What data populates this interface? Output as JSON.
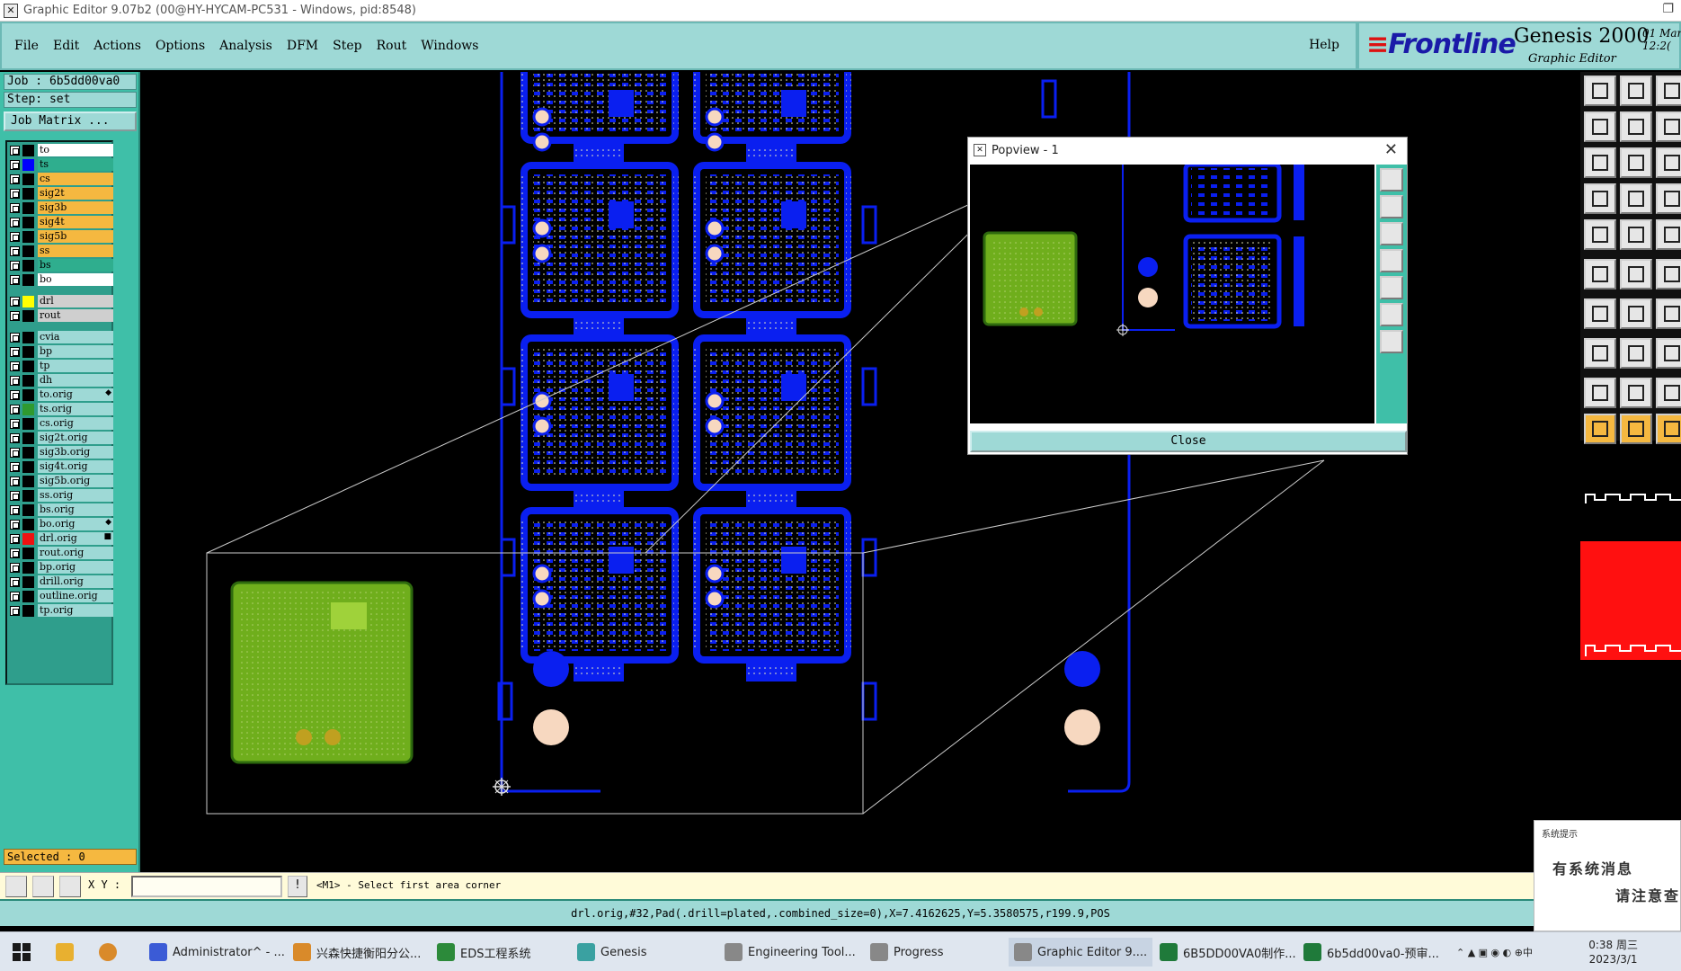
{
  "window": {
    "title": "Graphic Editor 9.07b2 (00@HY-HYCAM-PC531 - Windows, pid:8548)"
  },
  "menu": {
    "items": [
      "File",
      "Edit",
      "Actions",
      "Options",
      "Analysis",
      "DFM",
      "Step",
      "Rout",
      "Windows"
    ],
    "help": "Help"
  },
  "brand": {
    "logo": "Frontline",
    "product": "Genesis 2000",
    "subtitle": "Graphic Editor",
    "date": "01 Mar\n12:2("
  },
  "left": {
    "job": "Job : 6b5dd00va0",
    "step": "Step: set",
    "job_matrix": "Job Matrix ...",
    "selected": "Selected : 0"
  },
  "layers": [
    {
      "name": "to",
      "bg": "#ffffff",
      "swatch": "#000000"
    },
    {
      "name": "ts",
      "bg": "#2fae8e",
      "swatch": "#0000ff"
    },
    {
      "name": "cs",
      "bg": "#f5b840",
      "swatch": "#000000"
    },
    {
      "name": "sig2t",
      "bg": "#f5b840",
      "swatch": "#000000"
    },
    {
      "name": "sig3b",
      "bg": "#f5b840",
      "swatch": "#000000"
    },
    {
      "name": "sig4t",
      "bg": "#f5b840",
      "swatch": "#000000"
    },
    {
      "name": "sig5b",
      "bg": "#f5b840",
      "swatch": "#000000"
    },
    {
      "name": "ss",
      "bg": "#f5b840",
      "swatch": "#000000"
    },
    {
      "name": "bs",
      "bg": "#2fae8e",
      "swatch": "#000000"
    },
    {
      "name": "bo",
      "bg": "#ffffff",
      "swatch": "#000000"
    },
    {
      "name": "drl",
      "bg": "#cfcfcf",
      "swatch": "#ffff00",
      "gap": true
    },
    {
      "name": "rout",
      "bg": "#cfcfcf",
      "swatch": "#000000"
    },
    {
      "name": "cvia",
      "bg": "#9ed9d6",
      "swatch": "#000000",
      "gap": true
    },
    {
      "name": "bp",
      "bg": "#9ed9d6",
      "swatch": "#000000"
    },
    {
      "name": "tp",
      "bg": "#9ed9d6",
      "swatch": "#000000"
    },
    {
      "name": "dh",
      "bg": "#9ed9d6",
      "swatch": "#000000"
    },
    {
      "name": "to.orig",
      "bg": "#9ed9d6",
      "swatch": "#000000",
      "mark": "◆"
    },
    {
      "name": "ts.orig",
      "bg": "#9ed9d6",
      "swatch": "#2f9a2f"
    },
    {
      "name": "cs.orig",
      "bg": "#9ed9d6",
      "swatch": "#000000"
    },
    {
      "name": "sig2t.orig",
      "bg": "#9ed9d6",
      "swatch": "#000000"
    },
    {
      "name": "sig3b.orig",
      "bg": "#9ed9d6",
      "swatch": "#000000"
    },
    {
      "name": "sig4t.orig",
      "bg": "#9ed9d6",
      "swatch": "#000000"
    },
    {
      "name": "sig5b.orig",
      "bg": "#9ed9d6",
      "swatch": "#000000"
    },
    {
      "name": "ss.orig",
      "bg": "#9ed9d6",
      "swatch": "#000000"
    },
    {
      "name": "bs.orig",
      "bg": "#9ed9d6",
      "swatch": "#000000"
    },
    {
      "name": "bo.orig",
      "bg": "#9ed9d6",
      "swatch": "#000000",
      "mark": "◆"
    },
    {
      "name": "drl.orig",
      "bg": "#9ed9d6",
      "swatch": "#ee1111",
      "mark": "■"
    },
    {
      "name": "rout.orig",
      "bg": "#9ed9d6",
      "swatch": "#000000"
    },
    {
      "name": "bp.orig",
      "bg": "#9ed9d6",
      "swatch": "#000000"
    },
    {
      "name": "drill.orig",
      "bg": "#9ed9d6",
      "swatch": "#000000"
    },
    {
      "name": "outline.orig",
      "bg": "#9ed9d6",
      "swatch": "#000000"
    },
    {
      "name": "tp.orig",
      "bg": "#9ed9d6",
      "swatch": "#000000"
    }
  ],
  "popview": {
    "title": "Popview - 1",
    "close": "Close"
  },
  "command": {
    "xy_label": "X Y :",
    "xy_value": "",
    "prompt": "<M1> - Select first area corner"
  },
  "status": "drl.orig,#32,Pad(.drill=plated,.combined_size=0),X=7.4162625,Y=5.3580575,r199.9,POS",
  "notification": {
    "title": "系统提示",
    "line1": "有系统消息",
    "line2": "请注意查"
  },
  "taskbar": {
    "items": [
      {
        "label": "Administrator^ - ...",
        "color": "#3b5bd6"
      },
      {
        "label": "兴森快捷衡阳分公...",
        "color": "#d98a2a"
      },
      {
        "label": "EDS工程系统",
        "color": "#2c8a3a"
      },
      {
        "label": "Genesis",
        "color": "#3aa1a1"
      },
      {
        "label": "Engineering Tool...",
        "color": "#888888"
      },
      {
        "label": "Progress",
        "color": "#888888"
      },
      {
        "label": "Graphic Editor 9....",
        "color": "#888888"
      },
      {
        "label": "6B5DD00VA0制作...",
        "color": "#1f7a3a"
      },
      {
        "label": "6b5dd00va0-预审...",
        "color": "#1f7a3a"
      }
    ],
    "time": "0:38 周三",
    "date": "2023/3/1",
    "ime": "中"
  },
  "colors": {
    "panel": "#9ed9d6",
    "panel_border": "#2a8a7a",
    "board_blue": "#0a1ff0",
    "board_green": "#6fae1c",
    "pad_cream": "#f7d8c0"
  }
}
